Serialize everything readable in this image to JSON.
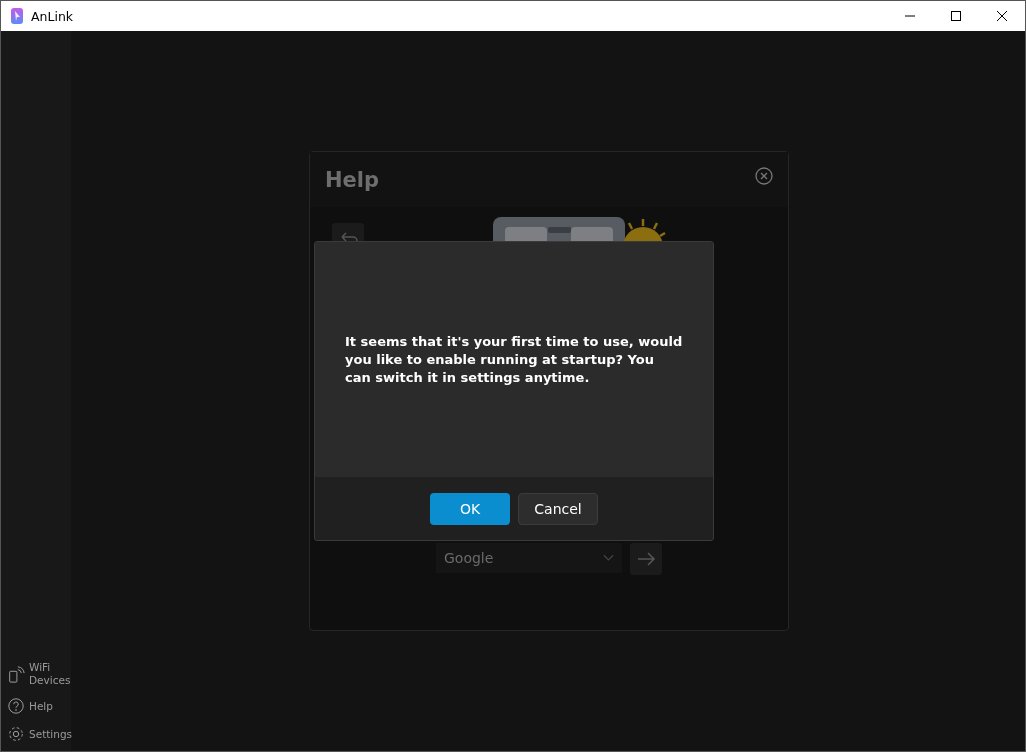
{
  "window": {
    "title": "AnLink"
  },
  "sidebar": {
    "items": [
      {
        "kind": "wifi",
        "label": "WiFi Devices"
      },
      {
        "kind": "help",
        "label": "Help"
      },
      {
        "kind": "settings",
        "label": "Settings"
      }
    ]
  },
  "help_panel": {
    "title": "Help",
    "search_engine": {
      "value": "Google"
    }
  },
  "dialog": {
    "message": "It seems that it's your first time to use, would you like to enable running at startup? You can switch it in settings anytime.",
    "buttons": [
      {
        "label": "OK",
        "kind": "primary"
      },
      {
        "label": "Cancel",
        "kind": "secondary"
      }
    ]
  }
}
